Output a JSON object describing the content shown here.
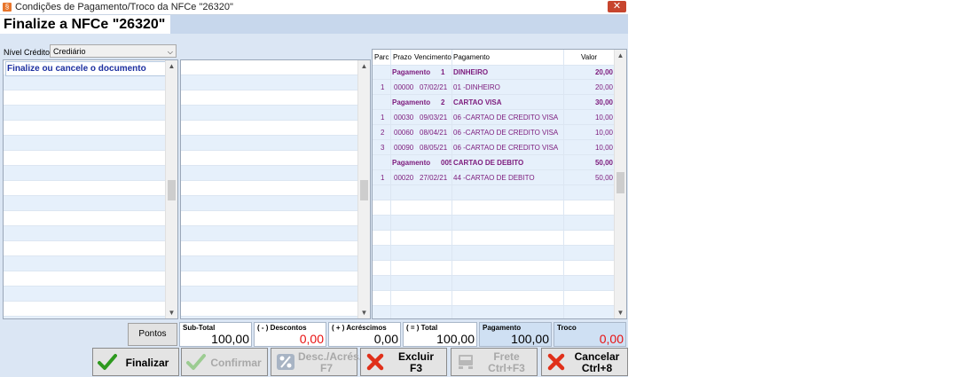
{
  "window": {
    "title": "Condições de Pagamento/Troco da NFCe \"26320\"",
    "close": "✕"
  },
  "heading": "Finalize a NFCe \"26320\"",
  "nivel": {
    "label": "Nível Crédito",
    "value": "Crediário"
  },
  "left_list": {
    "message": "Finalize ou cancele o documento"
  },
  "payments": {
    "columns": [
      "Parc",
      "Prazo",
      "Vencimento",
      "Pagamento",
      "Valor"
    ],
    "rows": [
      {
        "group": true,
        "label": "Pagamento",
        "num": "1",
        "name": "DINHEIRO",
        "valor": "20,00"
      },
      {
        "group": false,
        "parc": "1",
        "prazo": "00000",
        "venc": "07/02/21",
        "pag": "01 -DINHEIRO",
        "valor": "20,00"
      },
      {
        "group": true,
        "label": "Pagamento",
        "num": "2",
        "name": "CARTAO VISA",
        "valor": "30,00"
      },
      {
        "group": false,
        "parc": "1",
        "prazo": "00030",
        "venc": "09/03/21",
        "pag": "06 -CARTAO DE CREDITO VISA",
        "valor": "10,00"
      },
      {
        "group": false,
        "parc": "2",
        "prazo": "00060",
        "venc": "08/04/21",
        "pag": "06 -CARTAO DE CREDITO VISA",
        "valor": "10,00"
      },
      {
        "group": false,
        "parc": "3",
        "prazo": "00090",
        "venc": "08/05/21",
        "pag": "06 -CARTAO DE CREDITO VISA",
        "valor": "10,00"
      },
      {
        "group": true,
        "label": "Pagamento",
        "num": "005",
        "name": "CARTAO DE DEBITO",
        "valor": "50,00"
      },
      {
        "group": false,
        "parc": "1",
        "prazo": "00020",
        "venc": "27/02/21",
        "pag": "44 -CARTAO DE DEBITO",
        "valor": "50,00"
      }
    ]
  },
  "pontos_label": "Pontos",
  "totals": {
    "subtotal": {
      "label": "Sub-Total",
      "value": "100,00"
    },
    "descontos": {
      "label": "( - ) Descontos",
      "value": "0,00"
    },
    "acrescimos": {
      "label": "( + ) Acréscimos",
      "value": "0,00"
    },
    "total": {
      "label": "( = ) Total",
      "value": "100,00"
    },
    "pagamento": {
      "label": "Pagamento",
      "value": "100,00"
    },
    "troco": {
      "label": "Troco",
      "value": "0,00"
    }
  },
  "buttons": {
    "finalizar": {
      "label": "Finalizar"
    },
    "confirmar": {
      "label": "Confirmar"
    },
    "desc": {
      "line1": "Desc./Acrés.",
      "line2": "F7"
    },
    "excluir": {
      "line1": "Excluir",
      "line2": "F3"
    },
    "frete": {
      "line1": "Frete",
      "line2": "Ctrl+F3"
    },
    "cancelar": {
      "line1": "Cancelar",
      "line2": "Ctrl+8"
    }
  },
  "colors": {
    "negative": "#e81010",
    "payment_text": "#7c1a7c",
    "message": "#1c2fa0"
  }
}
